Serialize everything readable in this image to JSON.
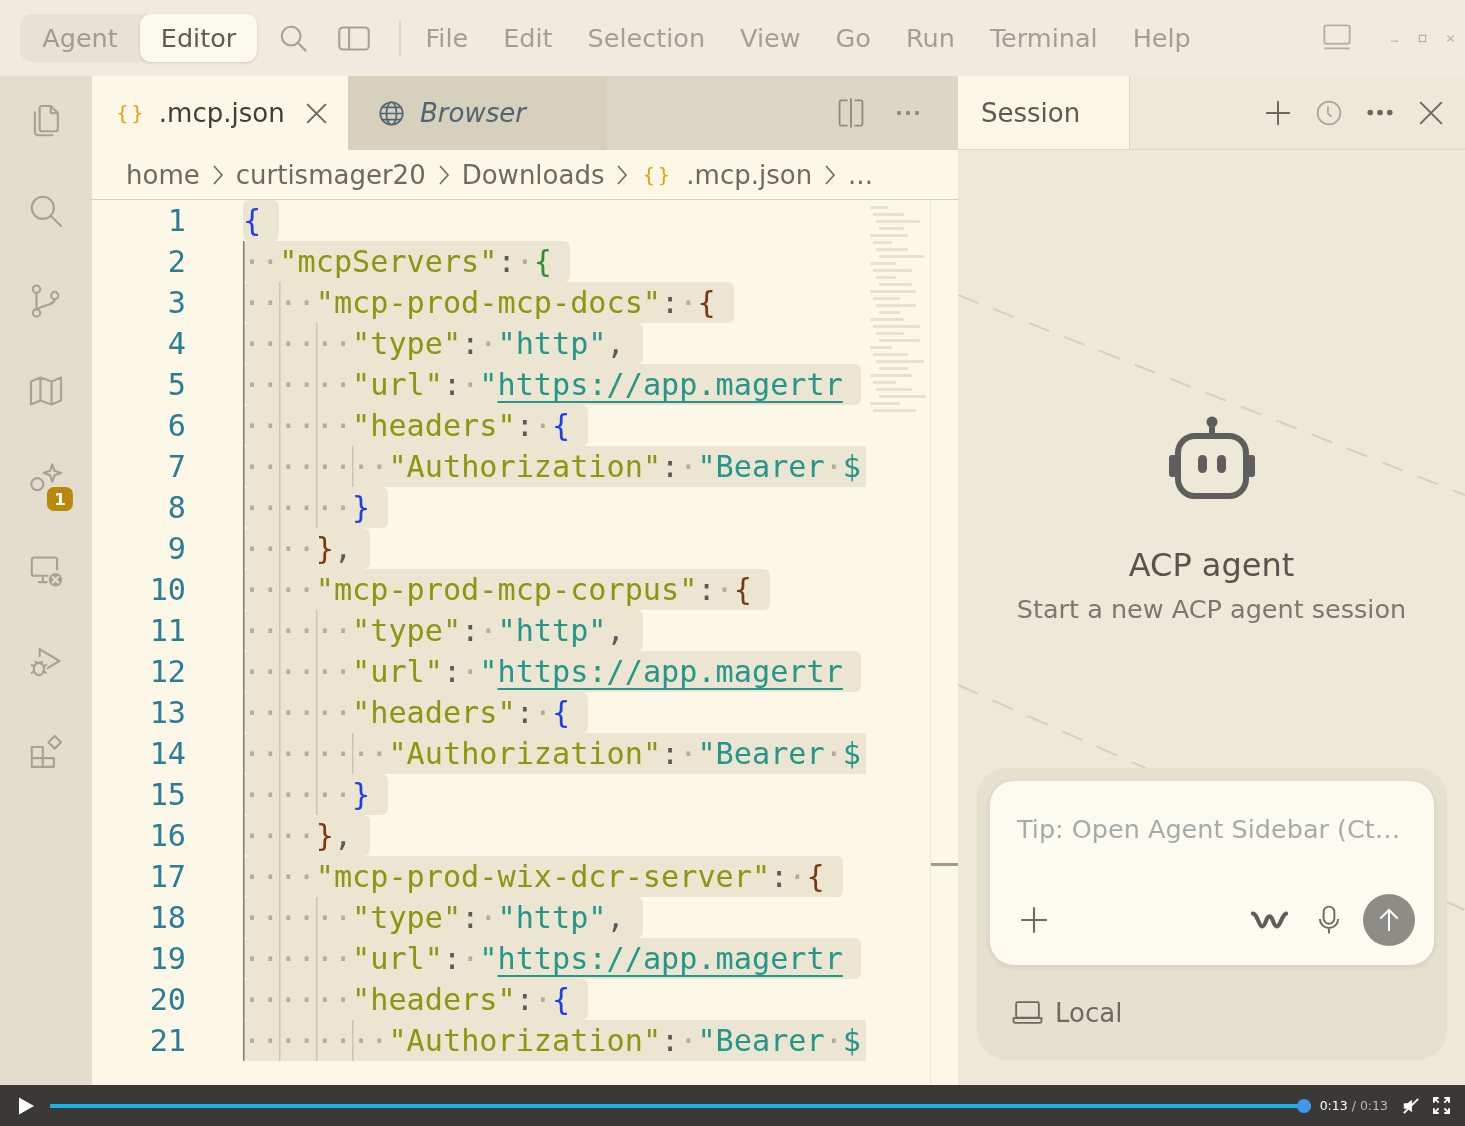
{
  "title_bar": {
    "modes": [
      {
        "label": "Agent",
        "selected": false
      },
      {
        "label": "Editor",
        "selected": true
      }
    ],
    "menu": [
      "File",
      "Edit",
      "Selection",
      "View",
      "Go",
      "Run",
      "Terminal",
      "Help"
    ]
  },
  "activity_bar": {
    "items": [
      {
        "kind": "files"
      },
      {
        "kind": "search"
      },
      {
        "kind": "branch"
      },
      {
        "kind": "map"
      },
      {
        "kind": "agent",
        "badge": "1"
      },
      {
        "kind": "remote"
      },
      {
        "kind": "debug"
      },
      {
        "kind": "extensions"
      }
    ]
  },
  "editor": {
    "tabs": [
      {
        "kind": "file",
        "icon": "{ }",
        "label": ".mcp.json",
        "selected": true,
        "preview": false
      },
      {
        "kind": "browser",
        "label": "Browser",
        "selected": false,
        "preview": true
      }
    ],
    "breadcrumbs": [
      {
        "label": "home"
      },
      {
        "label": "curtismager20"
      },
      {
        "label": "Downloads"
      },
      {
        "icon": "{ }",
        "label": ".mcp.json"
      },
      {
        "label": "..."
      }
    ],
    "lines": [
      {
        "number": "1",
        "selected": true,
        "tokens": [
          {
            "kind": "brace",
            "text": "{",
            "color": "#1f3fe6"
          }
        ]
      },
      {
        "number": "2",
        "selected": true,
        "tokens": [
          {
            "kind": "indent",
            "text": "··"
          },
          {
            "kind": "key",
            "text": "\"mcpServers\""
          },
          {
            "kind": "punct",
            "text": ":"
          },
          {
            "kind": "space",
            "text": "·"
          },
          {
            "kind": "brace",
            "text": "{",
            "color": "#2f8f2f"
          }
        ]
      },
      {
        "number": "3",
        "selected": true,
        "tokens": [
          {
            "kind": "indent",
            "text": "··"
          },
          {
            "kind": "indent",
            "text": "··"
          },
          {
            "kind": "key",
            "text": "\"mcp-prod-mcp-docs\""
          },
          {
            "kind": "punct",
            "text": ":"
          },
          {
            "kind": "space",
            "text": "·"
          },
          {
            "kind": "brace",
            "text": "{",
            "color": "#7b3814"
          }
        ]
      },
      {
        "number": "4",
        "selected": true,
        "tokens": [
          {
            "kind": "indent",
            "text": "··"
          },
          {
            "kind": "indent",
            "text": "··"
          },
          {
            "kind": "indent",
            "text": "··"
          },
          {
            "kind": "key",
            "text": "\"type\""
          },
          {
            "kind": "punct",
            "text": ":"
          },
          {
            "kind": "space",
            "text": "·"
          },
          {
            "kind": "string",
            "text": "\"http\""
          },
          {
            "kind": "punct",
            "text": ","
          }
        ]
      },
      {
        "number": "5",
        "selected": true,
        "tokens": [
          {
            "kind": "indent",
            "text": "··"
          },
          {
            "kind": "indent",
            "text": "··"
          },
          {
            "kind": "indent",
            "text": "··"
          },
          {
            "kind": "key",
            "text": "\"url\""
          },
          {
            "kind": "punct",
            "text": ":"
          },
          {
            "kind": "space",
            "text": "·"
          },
          {
            "kind": "string",
            "text": "\""
          },
          {
            "kind": "link",
            "text": "https://app.magertr"
          }
        ]
      },
      {
        "number": "6",
        "selected": true,
        "tokens": [
          {
            "kind": "indent",
            "text": "··"
          },
          {
            "kind": "indent",
            "text": "··"
          },
          {
            "kind": "indent",
            "text": "··"
          },
          {
            "kind": "key",
            "text": "\"headers\""
          },
          {
            "kind": "punct",
            "text": ":"
          },
          {
            "kind": "space",
            "text": "·"
          },
          {
            "kind": "brace",
            "text": "{",
            "color": "#1f3fe6"
          }
        ]
      },
      {
        "number": "7",
        "selected": true,
        "tokens": [
          {
            "kind": "indent",
            "text": "··"
          },
          {
            "kind": "indent",
            "text": "··"
          },
          {
            "kind": "indent",
            "text": "··"
          },
          {
            "kind": "indent",
            "text": "··"
          },
          {
            "kind": "key",
            "text": "\"Authorization\""
          },
          {
            "kind": "punct",
            "text": ":"
          },
          {
            "kind": "space",
            "text": "·"
          },
          {
            "kind": "string",
            "text": "\"Bearer"
          },
          {
            "kind": "space",
            "text": "·"
          },
          {
            "kind": "string",
            "text": "$"
          }
        ]
      },
      {
        "number": "8",
        "selected": true,
        "tokens": [
          {
            "kind": "indent",
            "text": "··"
          },
          {
            "kind": "indent",
            "text": "··"
          },
          {
            "kind": "indent",
            "text": "··"
          },
          {
            "kind": "brace",
            "text": "}",
            "color": "#1f3fe6"
          }
        ]
      },
      {
        "number": "9",
        "selected": true,
        "tokens": [
          {
            "kind": "indent",
            "text": "··"
          },
          {
            "kind": "indent",
            "text": "··"
          },
          {
            "kind": "brace",
            "text": "}",
            "color": "#7b3814"
          },
          {
            "kind": "punct",
            "text": ","
          }
        ]
      },
      {
        "number": "10",
        "selected": true,
        "tokens": [
          {
            "kind": "indent",
            "text": "··"
          },
          {
            "kind": "indent",
            "text": "··"
          },
          {
            "kind": "key",
            "text": "\"mcp-prod-mcp-corpus\""
          },
          {
            "kind": "punct",
            "text": ":"
          },
          {
            "kind": "space",
            "text": "·"
          },
          {
            "kind": "brace",
            "text": "{",
            "color": "#7b3814"
          }
        ]
      },
      {
        "number": "11",
        "selected": true,
        "tokens": [
          {
            "kind": "indent",
            "text": "··"
          },
          {
            "kind": "indent",
            "text": "··"
          },
          {
            "kind": "indent",
            "text": "··"
          },
          {
            "kind": "key",
            "text": "\"type\""
          },
          {
            "kind": "punct",
            "text": ":"
          },
          {
            "kind": "space",
            "text": "·"
          },
          {
            "kind": "string",
            "text": "\"http\""
          },
          {
            "kind": "punct",
            "text": ","
          }
        ]
      },
      {
        "number": "12",
        "selected": true,
        "tokens": [
          {
            "kind": "indent",
            "text": "··"
          },
          {
            "kind": "indent",
            "text": "··"
          },
          {
            "kind": "indent",
            "text": "··"
          },
          {
            "kind": "key",
            "text": "\"url\""
          },
          {
            "kind": "punct",
            "text": ":"
          },
          {
            "kind": "space",
            "text": "·"
          },
          {
            "kind": "string",
            "text": "\""
          },
          {
            "kind": "link",
            "text": "https://app.magertr"
          }
        ]
      },
      {
        "number": "13",
        "selected": true,
        "tokens": [
          {
            "kind": "indent",
            "text": "··"
          },
          {
            "kind": "indent",
            "text": "··"
          },
          {
            "kind": "indent",
            "text": "··"
          },
          {
            "kind": "key",
            "text": "\"headers\""
          },
          {
            "kind": "punct",
            "text": ":"
          },
          {
            "kind": "space",
            "text": "·"
          },
          {
            "kind": "brace",
            "text": "{",
            "color": "#1f3fe6"
          }
        ]
      },
      {
        "number": "14",
        "selected": true,
        "tokens": [
          {
            "kind": "indent",
            "text": "··"
          },
          {
            "kind": "indent",
            "text": "··"
          },
          {
            "kind": "indent",
            "text": "··"
          },
          {
            "kind": "indent",
            "text": "··"
          },
          {
            "kind": "key",
            "text": "\"Authorization\""
          },
          {
            "kind": "punct",
            "text": ":"
          },
          {
            "kind": "space",
            "text": "·"
          },
          {
            "kind": "string",
            "text": "\"Bearer"
          },
          {
            "kind": "space",
            "text": "·"
          },
          {
            "kind": "string",
            "text": "$"
          }
        ]
      },
      {
        "number": "15",
        "selected": true,
        "tokens": [
          {
            "kind": "indent",
            "text": "··"
          },
          {
            "kind": "indent",
            "text": "··"
          },
          {
            "kind": "indent",
            "text": "··"
          },
          {
            "kind": "brace",
            "text": "}",
            "color": "#1f3fe6"
          }
        ]
      },
      {
        "number": "16",
        "selected": true,
        "tokens": [
          {
            "kind": "indent",
            "text": "··"
          },
          {
            "kind": "indent",
            "text": "··"
          },
          {
            "kind": "brace",
            "text": "}",
            "color": "#7b3814"
          },
          {
            "kind": "punct",
            "text": ","
          }
        ]
      },
      {
        "number": "17",
        "selected": true,
        "tokens": [
          {
            "kind": "indent",
            "text": "··"
          },
          {
            "kind": "indent",
            "text": "··"
          },
          {
            "kind": "key",
            "text": "\"mcp-prod-wix-dcr-server\""
          },
          {
            "kind": "punct",
            "text": ":"
          },
          {
            "kind": "space",
            "text": "·"
          },
          {
            "kind": "brace",
            "text": "{",
            "color": "#7b3814"
          }
        ]
      },
      {
        "number": "18",
        "selected": true,
        "tokens": [
          {
            "kind": "indent",
            "text": "··"
          },
          {
            "kind": "indent",
            "text": "··"
          },
          {
            "kind": "indent",
            "text": "··"
          },
          {
            "kind": "key",
            "text": "\"type\""
          },
          {
            "kind": "punct",
            "text": ":"
          },
          {
            "kind": "space",
            "text": "·"
          },
          {
            "kind": "string",
            "text": "\"http\""
          },
          {
            "kind": "punct",
            "text": ","
          }
        ]
      },
      {
        "number": "19",
        "selected": true,
        "tokens": [
          {
            "kind": "indent",
            "text": "··"
          },
          {
            "kind": "indent",
            "text": "··"
          },
          {
            "kind": "indent",
            "text": "··"
          },
          {
            "kind": "key",
            "text": "\"url\""
          },
          {
            "kind": "punct",
            "text": ":"
          },
          {
            "kind": "space",
            "text": "·"
          },
          {
            "kind": "string",
            "text": "\""
          },
          {
            "kind": "link",
            "text": "https://app.magertr"
          }
        ]
      },
      {
        "number": "20",
        "selected": true,
        "tokens": [
          {
            "kind": "indent",
            "text": "··"
          },
          {
            "kind": "indent",
            "text": "··"
          },
          {
            "kind": "indent",
            "text": "··"
          },
          {
            "kind": "key",
            "text": "\"headers\""
          },
          {
            "kind": "punct",
            "text": ":"
          },
          {
            "kind": "space",
            "text": "·"
          },
          {
            "kind": "brace",
            "text": "{",
            "color": "#1f3fe6"
          }
        ]
      },
      {
        "number": "21",
        "selected": true,
        "tokens": [
          {
            "kind": "indent",
            "text": "··"
          },
          {
            "kind": "indent",
            "text": "··"
          },
          {
            "kind": "indent",
            "text": "··"
          },
          {
            "kind": "indent",
            "text": "··"
          },
          {
            "kind": "key",
            "text": "\"Authorization\""
          },
          {
            "kind": "punct",
            "text": ":"
          },
          {
            "kind": "space",
            "text": "·"
          },
          {
            "kind": "string",
            "text": "\"Bearer"
          },
          {
            "kind": "space",
            "text": "·"
          },
          {
            "kind": "string",
            "text": "$"
          }
        ]
      }
    ]
  },
  "agent_panel": {
    "tabs": [
      {
        "label": "Session",
        "selected": true
      }
    ],
    "title": "ACP agent",
    "subtitle": "Start a new ACP agent session",
    "composer": {
      "placeholder": "Tip: Open Agent Sidebar (Ct…"
    },
    "environment": "Local"
  },
  "video_player": {
    "playing": false,
    "muted": true,
    "level": 1,
    "elapsed": "0:13",
    "separator": "/",
    "total": "0:13"
  }
}
